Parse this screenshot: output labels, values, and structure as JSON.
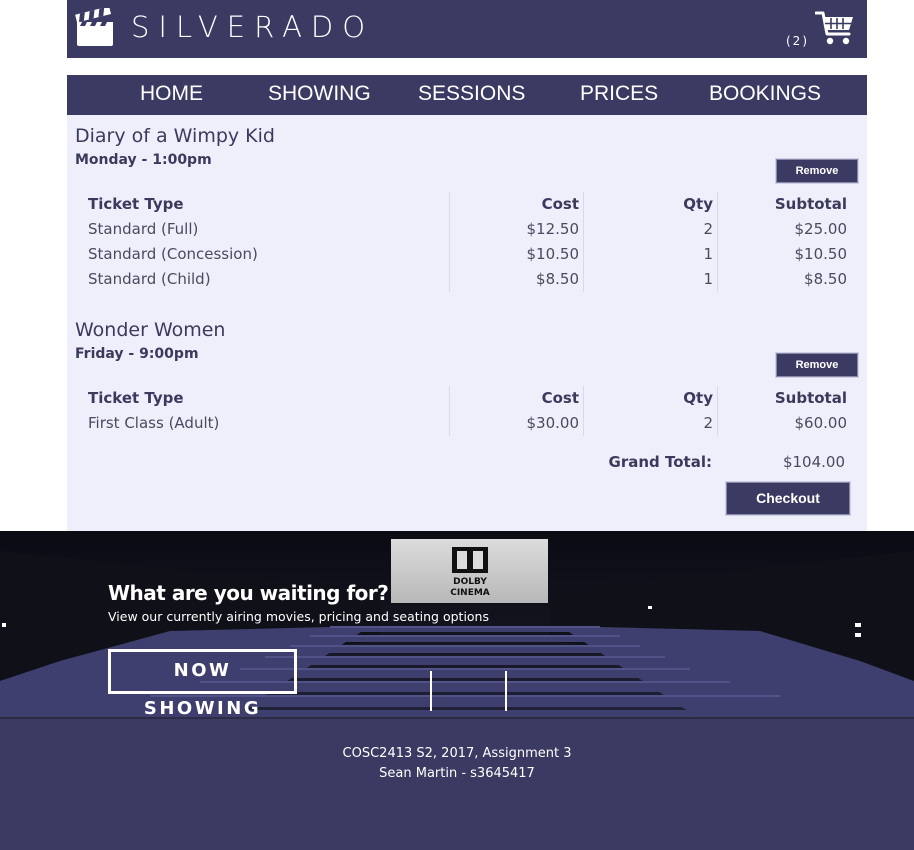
{
  "header": {
    "title": "SILVERADO",
    "cart_count": "(2)",
    "logo_icon": "clapperboard-icon",
    "cart_icon": "shopping-cart-icon"
  },
  "nav": {
    "items": [
      {
        "label": "HOME"
      },
      {
        "label": "SHOWING"
      },
      {
        "label": "SESSIONS"
      },
      {
        "label": "PRICES"
      },
      {
        "label": "BOOKINGS"
      }
    ]
  },
  "bookings": [
    {
      "film": "Diary of a Wimpy Kid",
      "session": "Monday - 1:00pm",
      "remove_label": "Remove",
      "headers": {
        "type": "Ticket Type",
        "cost": "Cost",
        "qty": "Qty",
        "subtotal": "Subtotal"
      },
      "rows": [
        {
          "type": "Standard (Full)",
          "cost": "$12.50",
          "qty": "2",
          "subtotal": "$25.00"
        },
        {
          "type": "Standard (Concession)",
          "cost": "$10.50",
          "qty": "1",
          "subtotal": "$10.50"
        },
        {
          "type": "Standard (Child)",
          "cost": "$8.50",
          "qty": "1",
          "subtotal": "$8.50"
        }
      ]
    },
    {
      "film": "Wonder Women",
      "session": "Friday - 9:00pm",
      "remove_label": "Remove",
      "headers": {
        "type": "Ticket Type",
        "cost": "Cost",
        "qty": "Qty",
        "subtotal": "Subtotal"
      },
      "rows": [
        {
          "type": "First Class (Adult)",
          "cost": "$30.00",
          "qty": "2",
          "subtotal": "$60.00"
        }
      ]
    }
  ],
  "totals": {
    "grand_label": "Grand Total:",
    "grand_value": "$104.00",
    "checkout_label": "Checkout"
  },
  "hero": {
    "title": "What are you waiting for?",
    "subtitle": "View our currently airing movies, pricing and seating options",
    "button_label": "NOW SHOWING",
    "screen_text_1": "DOLBY",
    "screen_text_2": "CINEMA"
  },
  "footer": {
    "line1": "COSC2413 S2, 2017, Assignment 3",
    "line2": "Sean Martin - s3645417"
  },
  "colors": {
    "brand": "#3b3a62",
    "panel": "#efeffb",
    "text": "#3b3a5c"
  }
}
